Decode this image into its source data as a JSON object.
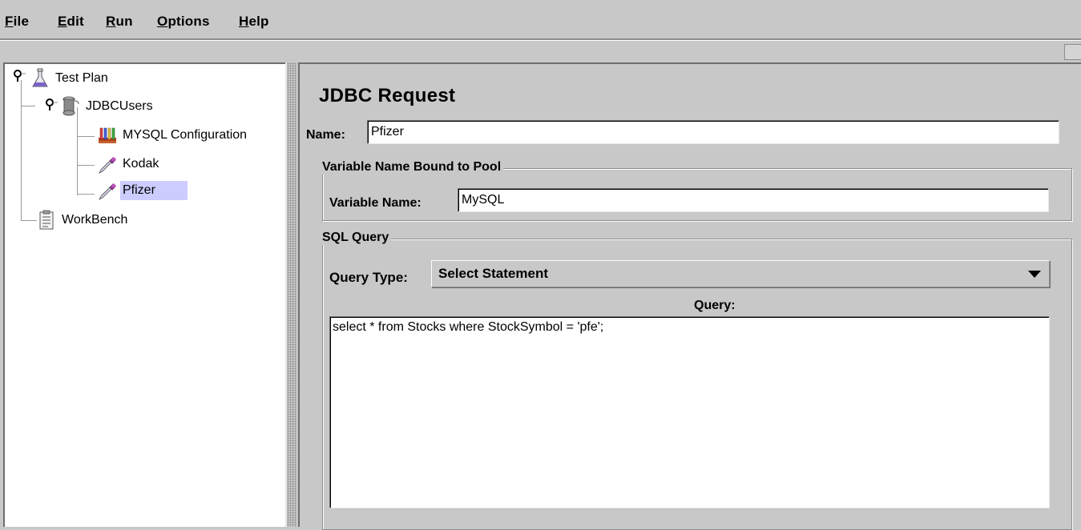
{
  "menubar": {
    "items": [
      {
        "mnemonic": "F",
        "rest": "ile"
      },
      {
        "mnemonic": "E",
        "rest": "dit"
      },
      {
        "mnemonic": "R",
        "rest": "un"
      },
      {
        "mnemonic": "O",
        "rest": "ptions"
      },
      {
        "mnemonic": "H",
        "rest": "elp"
      }
    ]
  },
  "tree": {
    "test_plan": {
      "label": "Test Plan",
      "icon": "flask-icon"
    },
    "jdbc_users": {
      "label": "JDBCUsers",
      "icon": "spool-icon"
    },
    "mysql_config": {
      "label": "MYSQL Configuration",
      "icon": "test-tubes-icon"
    },
    "kodak": {
      "label": "Kodak",
      "icon": "dropper-icon"
    },
    "pfizer": {
      "label": "Pfizer",
      "icon": "dropper-icon",
      "selected": true
    },
    "workbench": {
      "label": "WorkBench",
      "icon": "clipboard-icon"
    }
  },
  "editor": {
    "title": "JDBC Request",
    "name_label": "Name:",
    "name_value": "Pfizer",
    "pool_group": {
      "legend": "Variable Name Bound to Pool",
      "var_label": "Variable Name:",
      "var_value": "MySQL"
    },
    "sql_group": {
      "legend": "SQL Query",
      "type_label": "Query Type:",
      "type_value": "Select Statement",
      "query_label": "Query:",
      "query_value": "select * from Stocks where StockSymbol = 'pfe';"
    }
  },
  "colors": {
    "background": "#c8c8c8",
    "selection": "#ccccff"
  }
}
